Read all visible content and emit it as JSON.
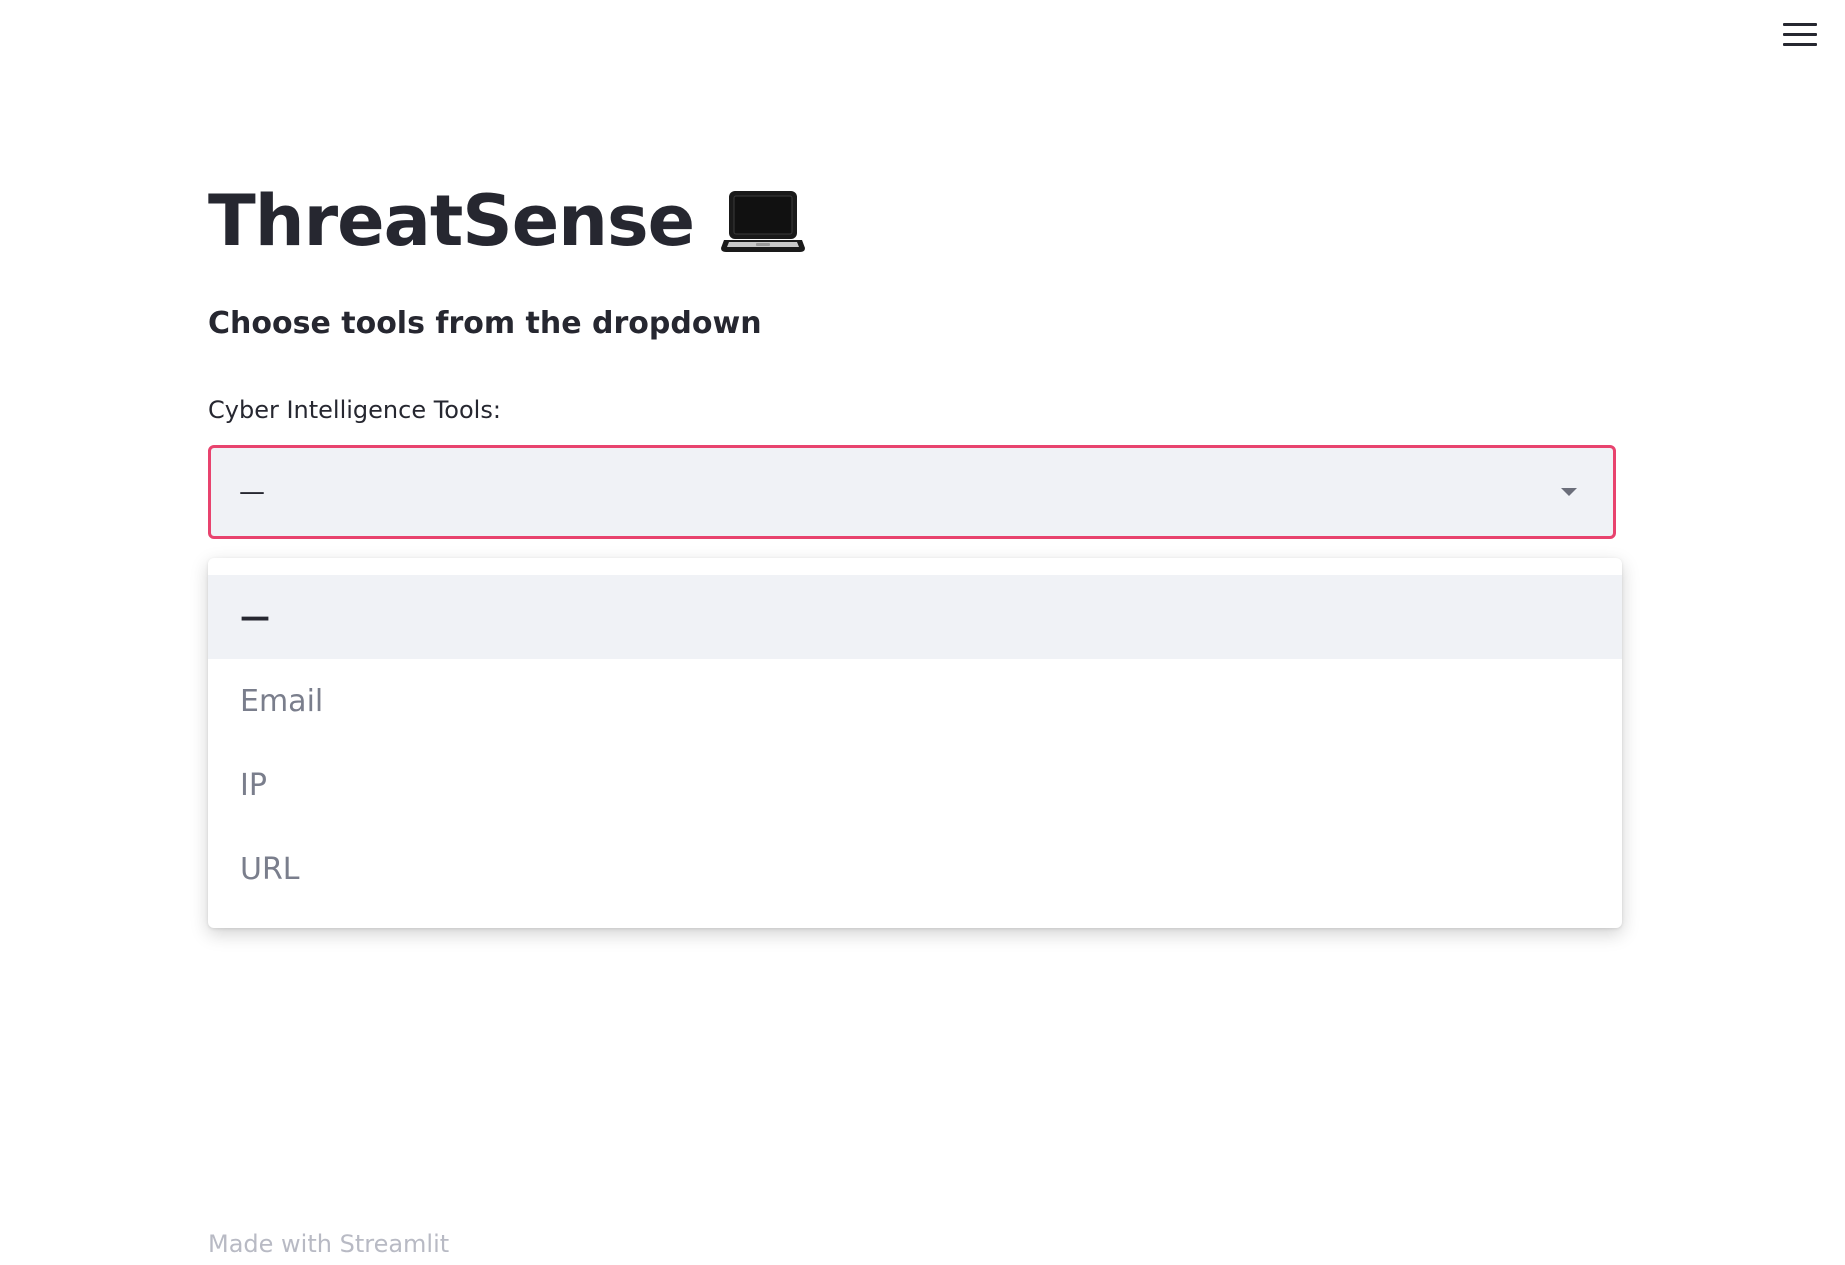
{
  "menu": {
    "icon": "hamburger-menu-icon"
  },
  "title": {
    "text": "ThreatSense",
    "icon": "laptop-icon"
  },
  "subheader": "Choose tools from the dropdown",
  "tool_select": {
    "label": "Cyber Intelligence Tools:",
    "value": "—",
    "accent_color": "#e8436e",
    "options": [
      "—",
      "Email",
      "IP",
      "URL"
    ],
    "highlighted_index": 0
  },
  "footer": {
    "text": "Made with Streamlit"
  }
}
